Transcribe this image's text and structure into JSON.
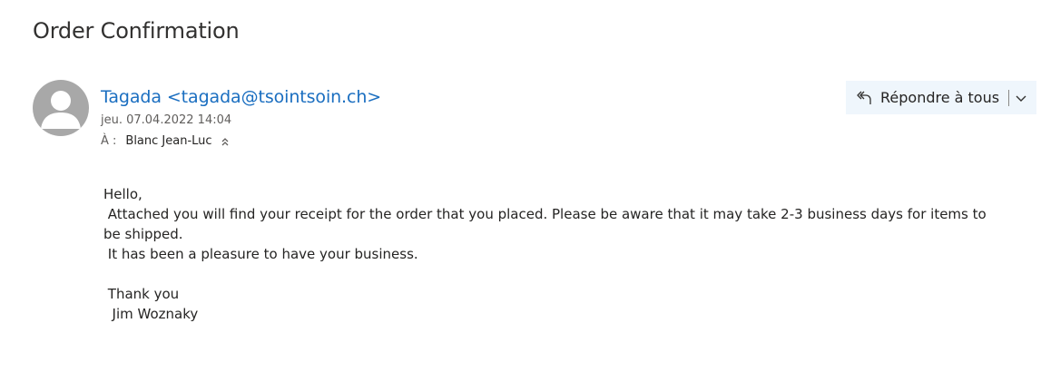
{
  "email": {
    "subject": "Order Confirmation",
    "sender": "Tagada <tagada@tsointsoin.ch>",
    "date": "jeu. 07.04.2022 14:04",
    "to_label": "À :",
    "to_name": "Blanc Jean-Luc",
    "reply_all_label": "Répondre à tous",
    "body": {
      "greeting": "Hello,",
      "line1": " Attached you will find your receipt for the order that you placed. Please be aware that it may take 2-3 business days for items to be shipped.",
      "line2": " It has been a pleasure to have your business.",
      "closing": " Thank you",
      "signature": "  Jim Woznaky"
    }
  },
  "icons": {
    "avatar": "person-icon",
    "reply_all": "reply-all-icon",
    "dropdown": "chevron-down-icon",
    "expand": "chevron-double-up-icon"
  },
  "colors": {
    "sender_link": "#1a6ec0",
    "reply_bar_bg": "#eff6fc",
    "avatar_bg": "#a8a8a8"
  }
}
